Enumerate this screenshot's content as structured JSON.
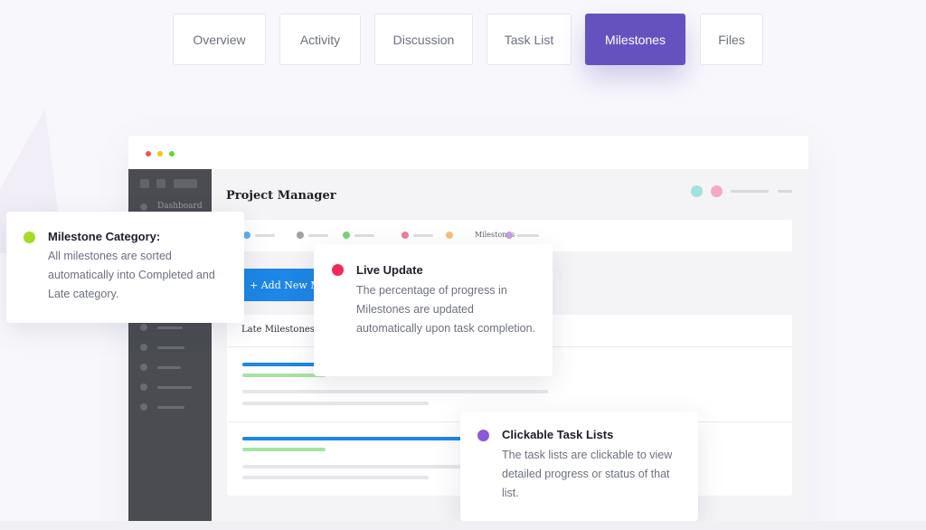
{
  "tabs": [
    {
      "label": "Overview",
      "active": false
    },
    {
      "label": "Activity",
      "active": false
    },
    {
      "label": "Discussion",
      "active": false
    },
    {
      "label": "Task List",
      "active": false
    },
    {
      "label": "Milestones",
      "active": true
    },
    {
      "label": "Files",
      "active": false
    }
  ],
  "colors": {
    "accent": "#6652bf",
    "window_dot_red": "#ef5350",
    "window_dot_yellow": "#f5c518",
    "window_dot_green": "#6bd23a",
    "sidebar_bg": "#4a4c52",
    "add_button": "#1d86e6",
    "progress_blue": "#1d86e6",
    "progress_green": "#a8e2a5"
  },
  "app": {
    "sidebar": {
      "dashboard_label": "Dashboard"
    },
    "title": "Project Manager",
    "filter_bar": {
      "milestones_label": "Milestones"
    },
    "add_button_label": "+ Add New Milestone",
    "late_milestones_label": "Late Milestones"
  },
  "tooltips": {
    "category": {
      "title": "Milestone Category:",
      "body": "All milestones are sorted automatically into Completed and Late category.",
      "dot_color": "#a3dc22"
    },
    "live_update": {
      "title": "Live Update",
      "body": "The percentage of progress in Milestones are updated automatically upon task completion.",
      "dot_color": "#f2295a"
    },
    "clickable": {
      "title": "Clickable Task Lists",
      "body": "The task lists are clickable to view detailed progress or status of that list.",
      "dot_color": "#8a5ad8"
    }
  }
}
